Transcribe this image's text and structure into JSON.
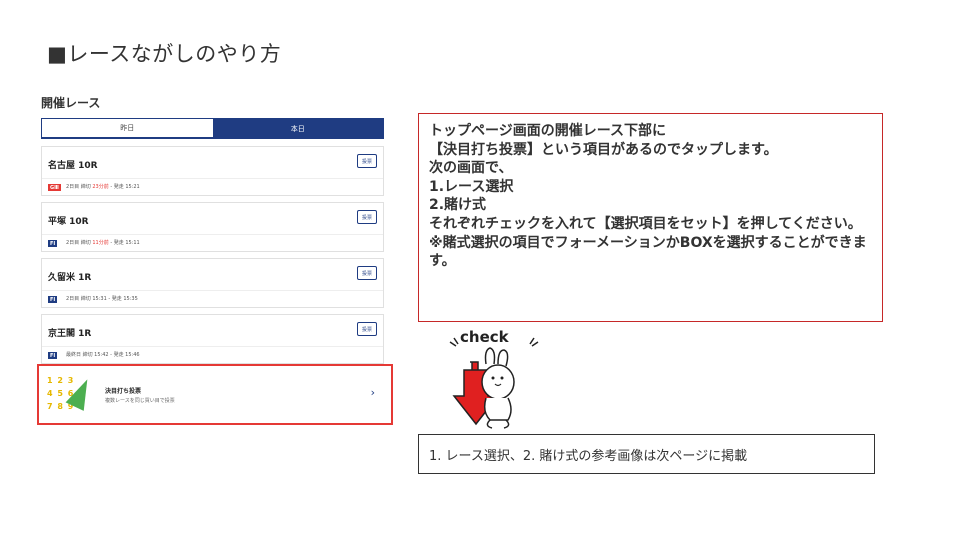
{
  "slide": {
    "title": "■レースながしのやり方"
  },
  "app": {
    "section_title": "開催レース",
    "tabs": [
      {
        "label": "昨日",
        "active": false
      },
      {
        "label": "本日",
        "active": true
      }
    ],
    "vote_label": "投票",
    "races": [
      {
        "name": "名古屋 10R",
        "grade": "GⅢ",
        "grade_color": "#e53935",
        "info_a": "2日目 締切 ",
        "info_hl": "23分前",
        "info_b": " - 発走 15:21"
      },
      {
        "name": "平塚 10R",
        "grade": "FⅠ",
        "grade_color": "#1f3c82",
        "info_a": "2日目 締切 ",
        "info_hl": "11分前",
        "info_b": " - 発走 15:11"
      },
      {
        "name": "久留米 1R",
        "grade": "FⅠ",
        "grade_color": "#1f3c82",
        "info_a": "2日目 締切 15:31 - 発走 15:35",
        "info_hl": "",
        "info_b": ""
      },
      {
        "name": "京王閣 1R",
        "grade": "FⅠ",
        "grade_color": "#1f3c82",
        "info_a": "最終日 締切 15:42 - 発走 15:46",
        "info_hl": "",
        "info_b": ""
      }
    ],
    "kimeuchi": {
      "title": "決目打ち投票",
      "subtitle": "複数レースを同じ買い目で投票",
      "thumb_rows": [
        "1 2 3",
        "4 5 6",
        "7 8 9"
      ]
    }
  },
  "instructions": {
    "lines": [
      "トップページ画面の開催レース下部に",
      "【決目打ち投票】という項目があるのでタップします。",
      "次の画面で、",
      "1.レース選択",
      "2.賭け式",
      "それぞれチェックを入れて【選択項目をセット】を押してください。",
      "※賭式選択の項目でフォーメーションかBOXを選択することができます。"
    ]
  },
  "check_label": "check",
  "note": "1. レース選択、2. 賭け式の参考画像は次ページに掲載",
  "colors": {
    "accent": "#1f3c82",
    "highlight": "#e53935",
    "info_border": "#c62828"
  }
}
